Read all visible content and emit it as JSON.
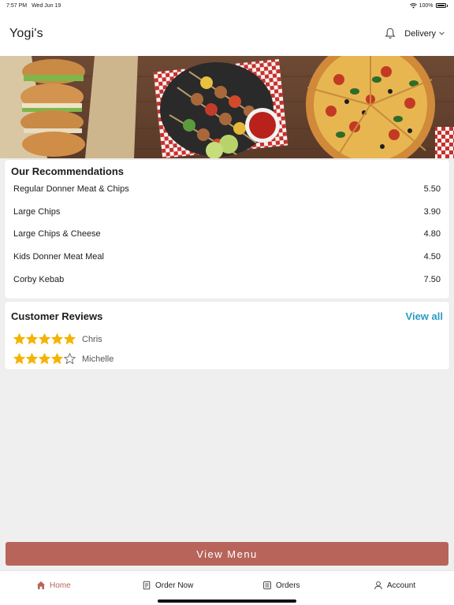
{
  "status_bar": {
    "time": "7:57 PM",
    "date": "Wed Jun 19",
    "battery": "100%"
  },
  "header": {
    "title": "Yogi's",
    "mode_label": "Delivery",
    "icons": [
      "bell-icon",
      "chevron-down-icon"
    ]
  },
  "recommendations": {
    "title": "Our Recommendations",
    "items": [
      {
        "name": "Regular Donner Meat & Chips",
        "price": "5.50"
      },
      {
        "name": "Large Chips",
        "price": "3.90"
      },
      {
        "name": "Large Chips & Cheese",
        "price": "4.80"
      },
      {
        "name": "Kids Donner Meat Meal",
        "price": "4.50"
      },
      {
        "name": "Corby Kebab",
        "price": "7.50"
      }
    ]
  },
  "reviews": {
    "title": "Customer Reviews",
    "view_all": "View all",
    "items": [
      {
        "name": "Chris",
        "rating": 5
      },
      {
        "name": "Michelle",
        "rating": 4
      }
    ]
  },
  "view_menu": "View Menu",
  "tabs": {
    "home": "Home",
    "order_now": "Order Now",
    "orders": "Orders",
    "account": "Account"
  },
  "colors": {
    "accent": "#b8645a",
    "link": "#2c9bc2",
    "star": "#f5b301"
  }
}
